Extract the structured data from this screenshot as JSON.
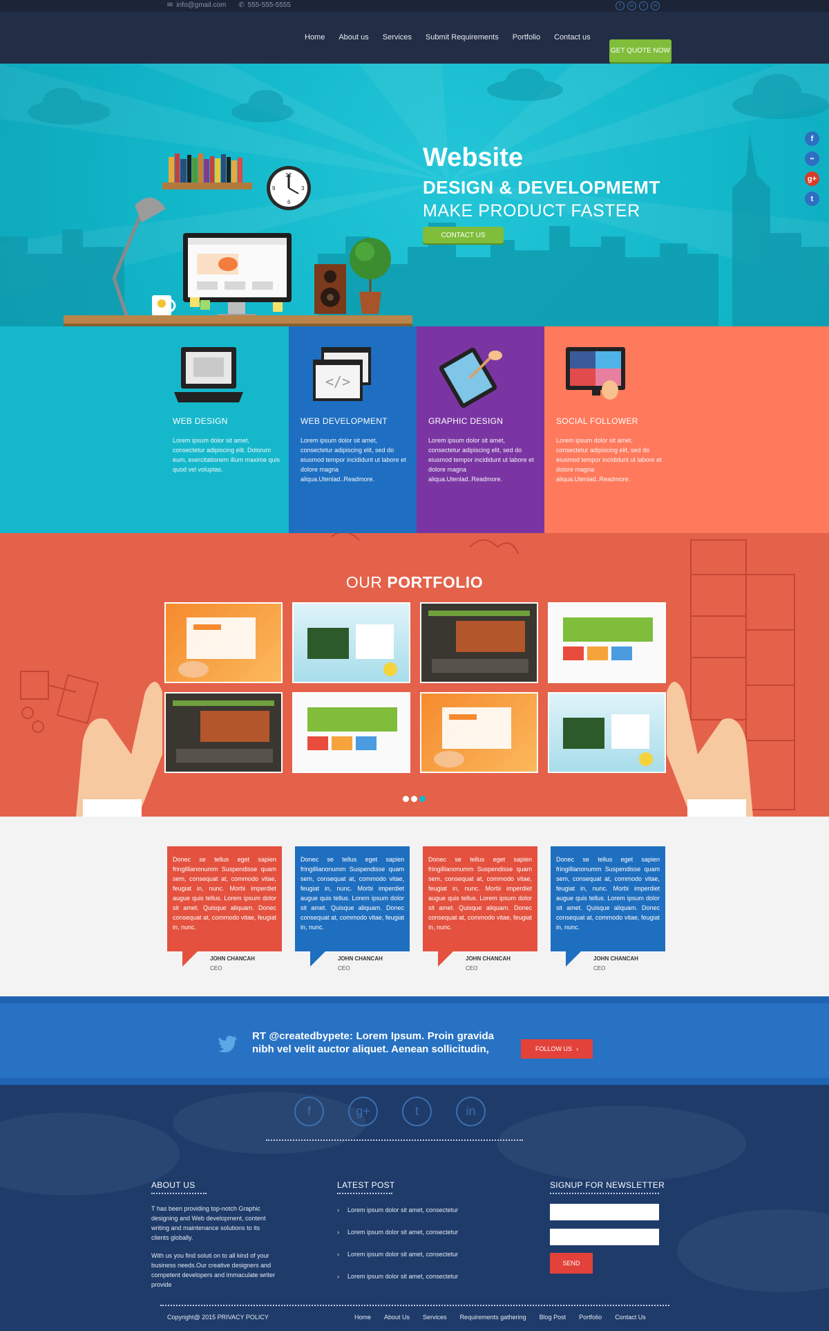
{
  "topbar": {
    "email": "info@gmail.com",
    "phone": "555-555-5555",
    "socials": [
      "f",
      "g+",
      "t",
      "in"
    ]
  },
  "nav": {
    "items": [
      "Home",
      "About us",
      "Services",
      "Submit Requirements",
      "Portfolio",
      "Contact us"
    ],
    "cta": "GET QUOTE NOW"
  },
  "hero": {
    "title": "Website",
    "subtitle1": "DESIGN & DEVELOPMEMT",
    "subtitle2": "MAKE PRODUCT FASTER",
    "button": "CONTACT US",
    "clock_numbers": [
      "12",
      "3",
      "6",
      "9"
    ],
    "side_socials": [
      "f",
      "••",
      "g+",
      "t"
    ]
  },
  "services": [
    {
      "title": "WEB DESIGN",
      "text": "Lorem ipsum dolor sit amet, consectetur adipiscing elit. Dolorum eum, exercitationem illum maxime quis quod vel voluptas.",
      "color": "#15b7cb"
    },
    {
      "title": "WEB DEVELOPMENT",
      "text": "Lorem ipsum dolor sit amet, consectetur adipiscing elit, sed do eiusmod tempor incididunt ut labore et dolore magna aliqua.Utenlad..Readmore.",
      "color": "#1e6fc2"
    },
    {
      "title": "GRAPHIC DESIGN",
      "text": "Lorem ipsum dolor sit amet, consectetur adipiscing elit, sed do eiusmod tempor incididunt ut labore et dolore magna aliqua.Utenlad..Readmore.",
      "color": "#7b35a3"
    },
    {
      "title": "SOCIAL FOLLOWER",
      "text": "Lorem ipsum dolor sit amet, consectetur adipiscing elit, sed do eiusmod tempor incididunt ut labore et dolore magna aliqua.Utenlad..Readmore.",
      "color": "#ff7a5c"
    }
  ],
  "portfolio": {
    "title_light": "OUR",
    "title_bold": "PORTFOLIO",
    "thumbs": [
      "orange",
      "light",
      "dark",
      "white",
      "dark",
      "white",
      "orange",
      "light"
    ],
    "dots_active": 2
  },
  "testimonials": [
    {
      "text": "Donec se tellus eget sapien fringillianonumm Suspendisse quam sem, consequat at, commodo vitae, feugiat in, nunc. Morbi imperdiet augue quis tellus. Lorem ipsum dolor sit amet. Quisque aliquam. Donec consequat at, commodo vitae, feugiat in, nunc.",
      "name": "JOHN CHANCAH",
      "role": "CEO",
      "color": "#e4513f"
    },
    {
      "text": "Donec se tellus eget sapien fringillianonumm Suspendisse quam sem, consequat at, commodo vitae, feugiat in, nunc. Morbi imperdiet augue quis tellus. Lorem ipsum dolor sit amet. Quisque aliquam. Donec consequat at, commodo vitae, feugiat in, nunc.",
      "name": "JOHN CHANCAH",
      "role": "CEO",
      "color": "#1f6fc0"
    },
    {
      "text": "Donec se tellus eget sapien fringillianonumm Suspendisse quam sem, consequat at, commodo vitae, feugiat in, nunc. Morbi imperdiet augue quis tellus. Lorem ipsum dolor sit amet. Quisque aliquam. Donec consequat at, commodo vitae, feugiat in, nunc.",
      "name": "JOHN CHANCAH",
      "role": "CEO",
      "color": "#e4513f"
    },
    {
      "text": "Donec se tellus eget sapien fringillianonumm Suspendisse quam sem, consequat at, commodo vitae, feugiat in, nunc. Morbi imperdiet augue quis tellus. Lorem ipsum dolor sit amet. Quisque aliquam. Donec consequat at, commodo vitae, feugiat in, nunc.",
      "name": "JOHN CHANCAH",
      "role": "CEO",
      "color": "#1f6fc0"
    }
  ],
  "tweet": {
    "text": "RT @createdbypete: Lorem Ipsum. Proin gravida nibh vel velit auctor aliquet. Aenean sollicitudin,",
    "button": "FOLLOW US"
  },
  "footer": {
    "socials": [
      "f",
      "g+",
      "t",
      "in"
    ],
    "about": {
      "title": "ABOUT US",
      "p1": "T has been providing top-notch Graphic designing and Web development, content writing and maintenance solutions to its clients globally.",
      "p2": "With us you find soluti on to all kind of your business needs.Our creative designers and competent developers and immaculate writer provide"
    },
    "posts": {
      "title": "LATEST POST",
      "items": [
        "Lorem ipsum dolor sit amet, consectetur",
        "Lorem ipsum dolor sit amet, consectetur",
        "Lorem ipsum dolor sit amet, consectetur",
        "Lorem ipsum dolor sit amet, consectetur"
      ]
    },
    "newsletter": {
      "title": "SIGNUP FOR NEWSLETTER",
      "send": "SEND"
    },
    "copyright": "Copyright@ 2015 PRIVACY POLICY",
    "nav": [
      "Home",
      "About Us",
      "Services",
      "Requirements gathering",
      "Blog Post",
      "Portfolio",
      "Contact Us"
    ]
  }
}
